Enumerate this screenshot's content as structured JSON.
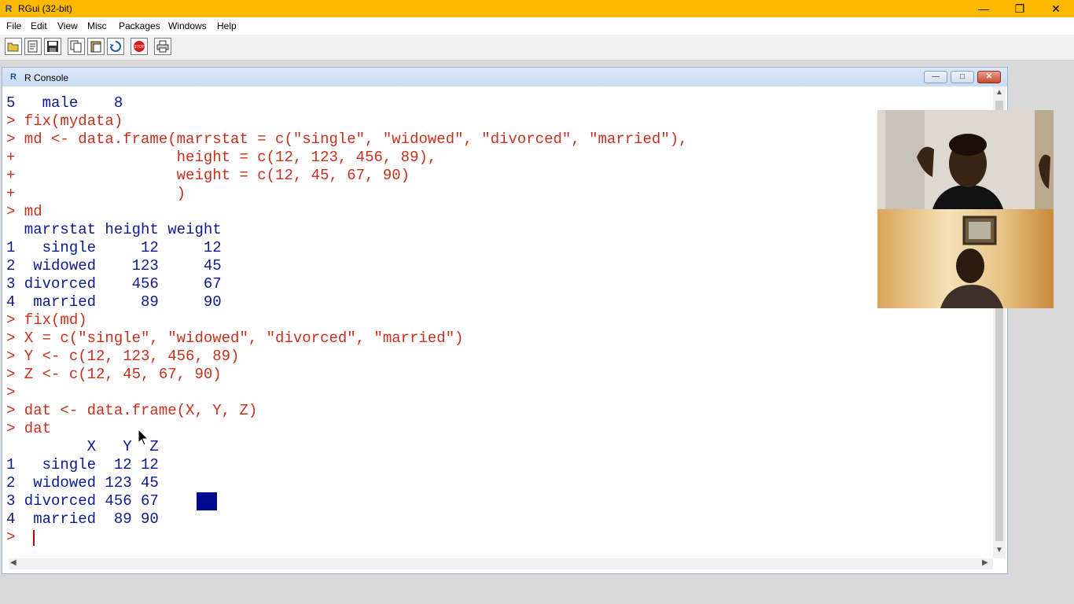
{
  "window": {
    "title": "RGui (32-bit)",
    "app_icon": "R"
  },
  "menu": [
    "File",
    "Edit",
    "View",
    "Misc",
    "Packages",
    "Windows",
    "Help"
  ],
  "toolbar": [
    "open-script-icon",
    "load-workspace-icon",
    "save-workspace-icon",
    "copy-icon",
    "paste-icon",
    "copy-paste-icon",
    "stop-icon",
    "print-icon"
  ],
  "console": {
    "title": "R Console",
    "lines": [
      {
        "t": "out",
        "s": "5   male    8"
      },
      {
        "t": "in",
        "s": "> fix(mydata)"
      },
      {
        "t": "in",
        "s": "> md <- data.frame(marrstat = c(\"single\", \"widowed\", \"divorced\", \"married\"),"
      },
      {
        "t": "in",
        "s": "+                  height = c(12, 123, 456, 89),"
      },
      {
        "t": "in",
        "s": "+                  weight = c(12, 45, 67, 90)"
      },
      {
        "t": "in",
        "s": "+                  )"
      },
      {
        "t": "in",
        "s": "> md"
      },
      {
        "t": "out",
        "s": "  marrstat height weight"
      },
      {
        "t": "out",
        "s": "1   single     12     12"
      },
      {
        "t": "out",
        "s": "2  widowed    123     45"
      },
      {
        "t": "out",
        "s": "3 divorced    456     67"
      },
      {
        "t": "out",
        "s": "4  married     89     90"
      },
      {
        "t": "in",
        "s": "> fix(md)"
      },
      {
        "t": "in",
        "s": "> X = c(\"single\", \"widowed\", \"divorced\", \"married\")"
      },
      {
        "t": "in",
        "s": "> Y <- c(12, 123, 456, 89)"
      },
      {
        "t": "in",
        "s": "> Z <- c(12, 45, 67, 90)"
      },
      {
        "t": "in",
        "s": ">"
      },
      {
        "t": "in",
        "s": "> dat <- data.frame(X, Y, Z)"
      },
      {
        "t": "in",
        "s": "> dat"
      },
      {
        "t": "out",
        "s": "         X   Y  Z"
      },
      {
        "t": "out",
        "s": "1   single  12 12"
      },
      {
        "t": "out",
        "s": "2  widowed 123 45"
      },
      {
        "t": "out",
        "s": "3 divorced 456 67"
      },
      {
        "t": "out",
        "s": "4  married  89 90"
      },
      {
        "t": "in",
        "s": "> "
      }
    ]
  },
  "colors": {
    "input": "#c8301e",
    "output": "#0b1a8c",
    "titlebar": "#ffb900"
  }
}
